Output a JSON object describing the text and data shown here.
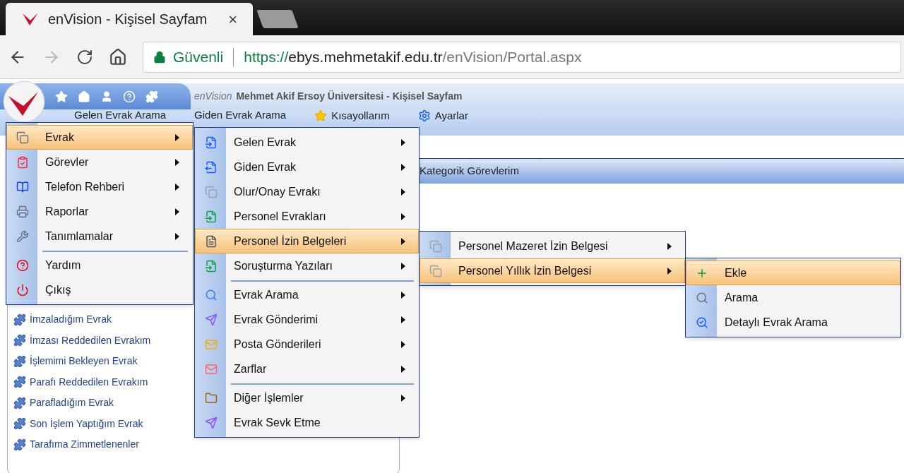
{
  "browser": {
    "tab_title": "enVision - Kişisel Sayfam",
    "close": "×",
    "security_label": "Güvenli",
    "url": {
      "scheme": "https://",
      "host": "ebys.mehmetakif.edu.tr",
      "path": "/enVision/Portal.aspx"
    }
  },
  "header": {
    "logo_text": "enVision",
    "title": "Mehmet Akif Ersoy Üniversitesi - Kişisel Sayfam"
  },
  "nav": [
    {
      "label": "Gelen Evrak Arama"
    },
    {
      "label": "Giden Evrak Arama"
    },
    {
      "label": "Kısayollarım"
    },
    {
      "label": "Ayarlar"
    }
  ],
  "quick_links": [
    "İmzaladığım Evrak",
    "İmzası Reddedilen Evrakım",
    "İşlemimi Bekleyen Evrak",
    "Parafı Reddedilen Evrakım",
    "Parafladığım Evrak",
    "Son İşlem Yaptığım Evrak",
    "Tarafıma Zimmetlenenler"
  ],
  "panel": {
    "title": "Kategorik Görevlerim"
  },
  "menus": [
    {
      "items": [
        {
          "label": "Evrak",
          "submenu": true,
          "selected": true,
          "separator_before": false
        },
        {
          "label": "Görevler",
          "submenu": true,
          "selected": false,
          "separator_before": false
        },
        {
          "label": "Telefon Rehberi",
          "submenu": true,
          "selected": false,
          "separator_before": false
        },
        {
          "label": "Raporlar",
          "submenu": true,
          "selected": false,
          "separator_before": false
        },
        {
          "label": "Tanımlamalar",
          "submenu": true,
          "selected": false,
          "separator_before": false
        },
        {
          "label": "Yardım",
          "submenu": false,
          "selected": false,
          "separator_before": true
        },
        {
          "label": "Çıkış",
          "submenu": false,
          "selected": false,
          "separator_before": false
        }
      ]
    },
    {
      "items": [
        {
          "label": "Gelen Evrak",
          "submenu": true,
          "selected": false,
          "separator_before": false
        },
        {
          "label": "Giden Evrak",
          "submenu": true,
          "selected": false,
          "separator_before": false
        },
        {
          "label": "Olur/Onay Evrakı",
          "submenu": true,
          "selected": false,
          "separator_before": false
        },
        {
          "label": "Personel Evrakları",
          "submenu": true,
          "selected": false,
          "separator_before": false
        },
        {
          "label": "Personel İzin Belgeleri",
          "submenu": true,
          "selected": true,
          "separator_before": false
        },
        {
          "label": "Soruşturma Yazıları",
          "submenu": true,
          "selected": false,
          "separator_before": false
        },
        {
          "label": "Evrak Arama",
          "submenu": true,
          "selected": false,
          "separator_before": true
        },
        {
          "label": "Evrak Gönderimi",
          "submenu": true,
          "selected": false,
          "separator_before": false
        },
        {
          "label": "Posta Gönderileri",
          "submenu": true,
          "selected": false,
          "separator_before": false
        },
        {
          "label": "Zarflar",
          "submenu": true,
          "selected": false,
          "separator_before": false
        },
        {
          "label": "Diğer İşlemler",
          "submenu": true,
          "selected": false,
          "separator_before": true
        },
        {
          "label": "Evrak Sevk Etme",
          "submenu": false,
          "selected": false,
          "separator_before": false
        }
      ]
    },
    {
      "items": [
        {
          "label": "Personel Mazeret İzin Belgesi",
          "submenu": true,
          "selected": false,
          "separator_before": false
        },
        {
          "label": "Personel Yıllık İzin Belgesi",
          "submenu": true,
          "selected": true,
          "separator_before": false
        }
      ]
    },
    {
      "items": [
        {
          "label": "Ekle",
          "submenu": false,
          "selected": true,
          "separator_before": false
        },
        {
          "label": "Arama",
          "submenu": false,
          "selected": false,
          "separator_before": false
        },
        {
          "label": "Detaylı Evrak Arama",
          "submenu": false,
          "selected": false,
          "separator_before": false
        }
      ]
    }
  ]
}
